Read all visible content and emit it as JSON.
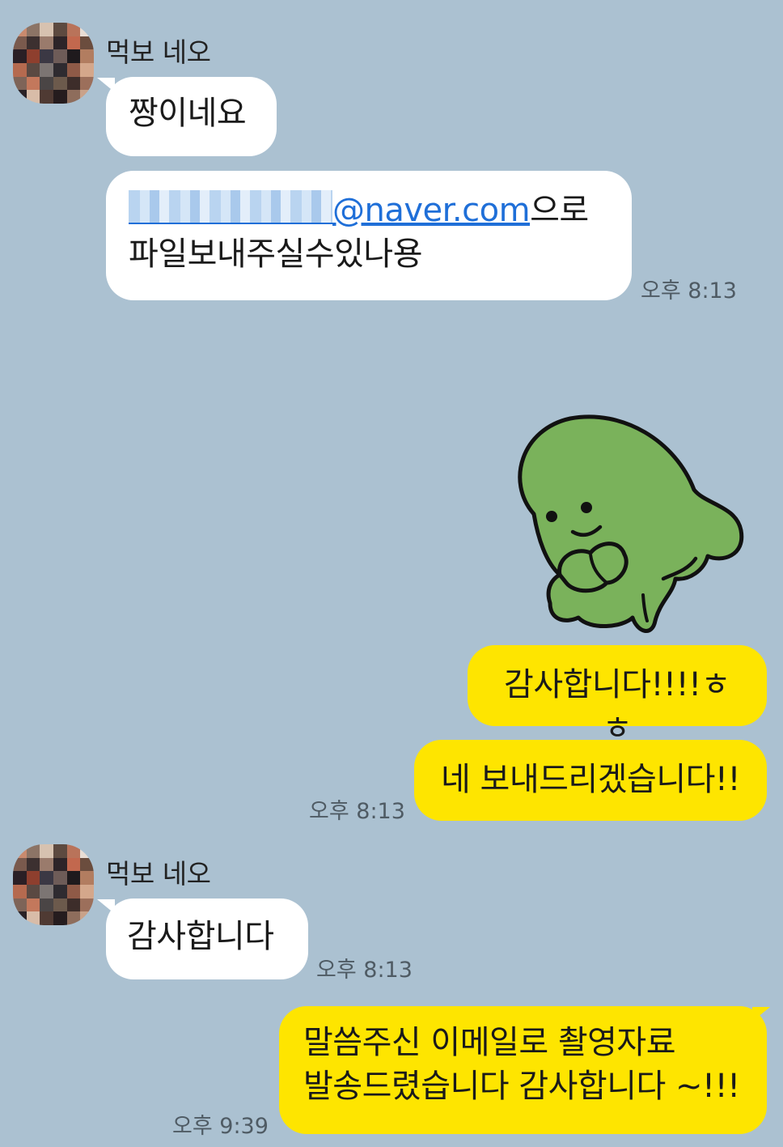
{
  "colors": {
    "background": "#abc1d1",
    "incoming_bubble": "#ffffff",
    "outgoing_bubble": "#fee500",
    "link": "#1f6fd8",
    "sticker": "#7ab25b"
  },
  "messages": [
    {
      "sender": "먹보 네오",
      "text": "짱이네요"
    },
    {
      "email_domain": "@naver.com",
      "email_suffix": "으로",
      "line2": "파일보내주실수있나용",
      "time": "오후 8:13"
    },
    {
      "sticker": "green-dinosaur-sticker"
    },
    {
      "text": "감사합니다!!!!ㅎㅎ"
    },
    {
      "text": "네 보내드리겠습니다!!",
      "time": "오후 8:13"
    },
    {
      "sender": "먹보 네오",
      "text": "감사합니다",
      "time": "오후 8:13"
    },
    {
      "line1": "말씀주신 이메일로 촬영자료",
      "line2": "발송드렸습니다 감사합니다 ~!!!",
      "time": "오후 9:39"
    }
  ]
}
